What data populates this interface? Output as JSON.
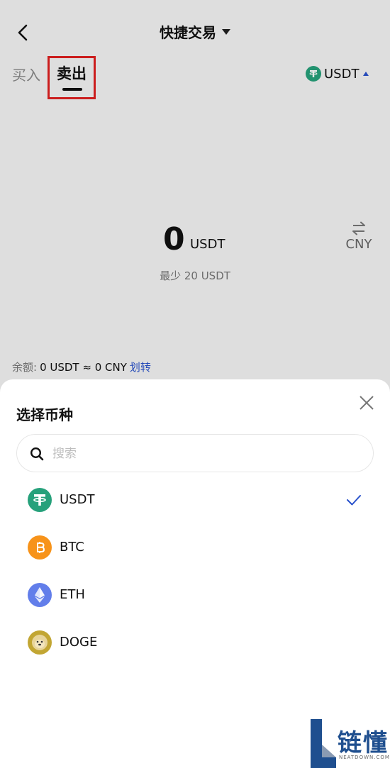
{
  "header": {
    "title": "快捷交易"
  },
  "tabs": {
    "buy": "买入",
    "sell": "卖出"
  },
  "coin_picker": {
    "label": "USDT"
  },
  "amount": {
    "value": "0",
    "unit": "USDT",
    "min_text": "最少 20 USDT",
    "swap_label": "CNY"
  },
  "balance": {
    "label": "余额:",
    "value": "0 USDT ≈ 0 CNY",
    "transfer_link": "划转"
  },
  "sheet": {
    "title": "选择币种",
    "search_placeholder": "搜索",
    "coins": [
      {
        "name": "USDT",
        "icon": "tether-icon",
        "color": "#26a17b",
        "selected": true
      },
      {
        "name": "BTC",
        "icon": "bitcoin-icon",
        "color": "#f7931a",
        "selected": false
      },
      {
        "name": "ETH",
        "icon": "ethereum-icon",
        "color": "#627eea",
        "selected": false
      },
      {
        "name": "DOGE",
        "icon": "dogecoin-icon",
        "color": "#c2a633",
        "selected": false
      }
    ]
  },
  "watermark": {
    "text": "链懂",
    "sub": "NEATDOWN.COM"
  },
  "colors": {
    "accent": "#2952cc",
    "highlight": "#e02020"
  }
}
